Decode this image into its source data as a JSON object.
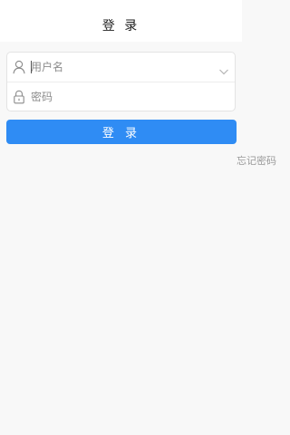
{
  "header": {
    "title": "登 录"
  },
  "form": {
    "username": {
      "placeholder": "用户名",
      "value": ""
    },
    "password": {
      "placeholder": "密码",
      "value": ""
    }
  },
  "login_button": {
    "label": "登 录",
    "color": "#2f8cf4"
  },
  "forgot_password": {
    "label": "忘记密码"
  },
  "icons": {
    "username": "user-icon",
    "password": "lock-icon",
    "username_dropdown": "chevron-down-icon"
  }
}
